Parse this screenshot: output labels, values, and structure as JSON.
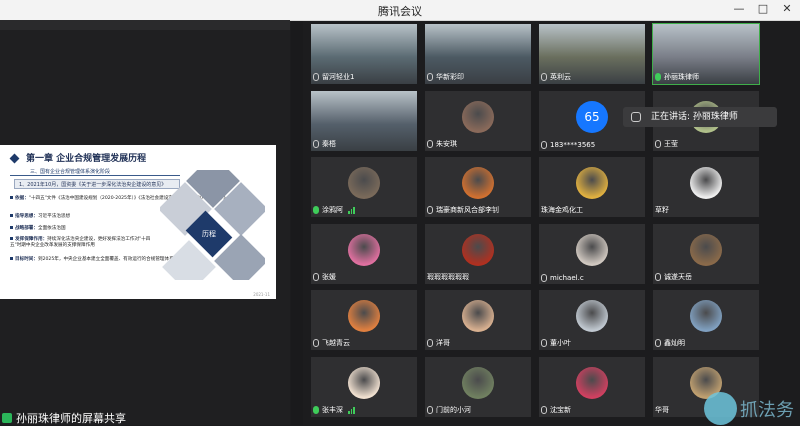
{
  "window": {
    "title": "腾讯会议",
    "minimize": "—",
    "maximize": "□",
    "close": "✕"
  },
  "slide": {
    "chapter": "第一章 企业合规管理发展历程",
    "section": "三、国有企业合规管理体系演化阶段",
    "item1": "1、2021年10月，国资委《关于进一步深化法治央企建设的意见》",
    "rows": [
      {
        "label": "依据：",
        "text": "\"十四五\"文件《法治中国建设规划（2020-2025年）》《法治社会建设实施纲要（2020-2025年）》"
      },
      {
        "label": "指导思想：",
        "text": "习近平法治思想"
      },
      {
        "label": "战略部署：",
        "text": "全面依法治国"
      },
      {
        "label": "发挥保障作用：",
        "text": "持续深化法治央企建设，更好发挥法治工作对\"十四五\"时期中央企业改革发展的支撑保障作用"
      },
      {
        "label": "目标时间：",
        "text": "到2025年，中央企业基本建立全面覆盖、有效运行的合规管理体系"
      }
    ],
    "badge": "历程",
    "footer": "2021-11"
  },
  "share_label": "孙丽珠律师的屏幕共享",
  "tooltip": "正在讲话: 孙丽珠律师",
  "participants": [
    {
      "name": "留河轻业1",
      "kind": "video",
      "mic": "off"
    },
    {
      "name": "华新彩印",
      "kind": "video",
      "mic": "off"
    },
    {
      "name": "英利云",
      "kind": "video",
      "mic": "off"
    },
    {
      "name": "孙丽珠律师",
      "kind": "video",
      "mic": "live",
      "active": true
    },
    {
      "name": "秦梧",
      "kind": "video",
      "mic": "off"
    },
    {
      "name": "朱安琪",
      "kind": "avatar",
      "mic": "off"
    },
    {
      "name": "183****3565",
      "kind": "number",
      "avatar_text": "65",
      "mic": "off"
    },
    {
      "name": "王莹",
      "kind": "avatar",
      "mic": "off"
    },
    {
      "name": "涂鸦阿",
      "kind": "avatar",
      "mic": "live"
    },
    {
      "name": "瑞豪商新风合部李钊",
      "kind": "avatar",
      "mic": "off"
    },
    {
      "name": "珠海金鸡化工",
      "kind": "avatar",
      "mic": "none"
    },
    {
      "name": "草籽",
      "kind": "avatar",
      "mic": "none"
    },
    {
      "name": "张媛",
      "kind": "avatar",
      "mic": "off"
    },
    {
      "name": "瑕瑕瑕瑕瑕瑕",
      "kind": "avatar",
      "mic": "none"
    },
    {
      "name": "michael.c",
      "kind": "avatar",
      "mic": "off"
    },
    {
      "name": "诚遂天岳",
      "kind": "avatar",
      "mic": "off"
    },
    {
      "name": "飞越青云",
      "kind": "avatar",
      "mic": "off"
    },
    {
      "name": "洋哥",
      "kind": "avatar",
      "mic": "off"
    },
    {
      "name": "董小叶",
      "kind": "avatar",
      "mic": "off"
    },
    {
      "name": "鑫灿明",
      "kind": "avatar",
      "mic": "off"
    },
    {
      "name": "张丰深",
      "kind": "avatar",
      "mic": "live"
    },
    {
      "name": "门前的小河",
      "kind": "avatar",
      "mic": "off"
    },
    {
      "name": "沈宝新",
      "kind": "avatar",
      "mic": "off"
    },
    {
      "name": "华哥",
      "kind": "avatar",
      "mic": "none"
    }
  ],
  "watermark": "抓法务",
  "colors": {
    "accent": "#1677ff",
    "speaking": "#3fcc5a",
    "slide_blue": "#1e3a6a"
  }
}
